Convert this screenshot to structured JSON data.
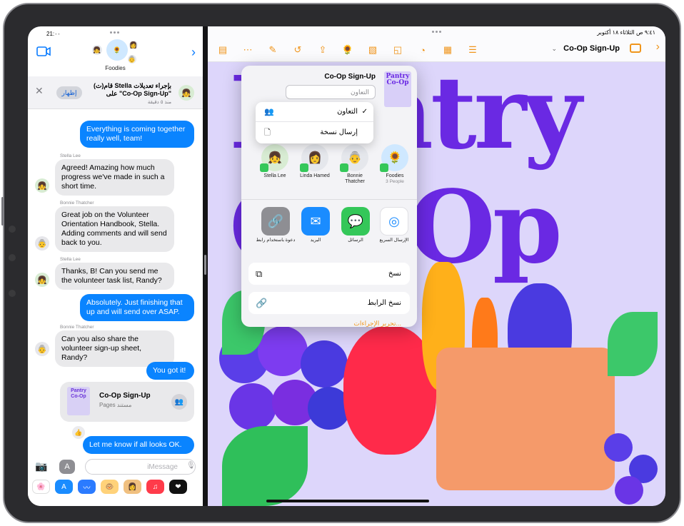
{
  "messages": {
    "status": {
      "time": "21:٠٠",
      "signal": "▮▮▮"
    },
    "header": {
      "group_name": "Foodies"
    },
    "banner": {
      "show_label": "إظهار",
      "line1": "قام(ت) Stella بإجراء تعديلات",
      "line2": "على \"Co-Op Sign-Up\"",
      "time": "منذ ٥ دقيقة"
    },
    "thread": [
      {
        "from": "me",
        "text": "Everything is coming together really well, team!"
      },
      {
        "from": "Stella Lee",
        "text": "Agreed! Amazing how much progress we've made in such a short time."
      },
      {
        "from": "Bonnie Thatcher",
        "text": "Great job on the Volunteer Orientation Handbook, Stella. Adding comments and will send back to you."
      },
      {
        "from": "Stella Lee",
        "text": "Thanks, B! Can you send me the volunteer task list, Randy?"
      },
      {
        "from": "me",
        "text": "Absolutely. Just finishing that up and will send over ASAP."
      },
      {
        "from": "Bonnie Thatcher",
        "text": "Can you also share the volunteer sign-up sheet, Randy?"
      },
      {
        "from": "me",
        "text": "You got it!"
      },
      {
        "from": "me",
        "text": "Let me know if all looks OK."
      }
    ],
    "sender_names": {
      "stella": "Stella Lee",
      "bonnie": "Bonnie Thatcher"
    },
    "card": {
      "title": "Co-Op Sign-Up",
      "subtitle": "Pages مستند",
      "thumb_text": "Pantry Co-Op"
    },
    "compose": {
      "placeholder": "iMessage"
    }
  },
  "pages": {
    "status": {
      "time": "٩:٤١ ص",
      "date": "الثلاثاء ١٨ أكتوبر"
    },
    "doc_title": "Co-Op Sign-Up",
    "poster": {
      "line1": "Pantry",
      "line2": "Co-Op"
    },
    "toolbar_icons": [
      "document-icon",
      "more-icon",
      "brush-icon",
      "undo-icon",
      "share-icon",
      "collab-icon",
      "media-icon",
      "shapes-icon",
      "chart-icon",
      "table-icon",
      "text-icon"
    ]
  },
  "share_sheet": {
    "title": "Co-Op Sign-Up",
    "thumb_text": "Pantry Co-Op",
    "collab_value": "التعاون",
    "dropdown": [
      {
        "label": "التعاون",
        "checked": true
      },
      {
        "label": "إرسال نسخة",
        "checked": false
      }
    ],
    "people": [
      {
        "name": "Foodies",
        "sub": "3 People"
      },
      {
        "name": "Bonnie Thatcher",
        "sub": ""
      },
      {
        "name": "Linda Hamed",
        "sub": ""
      },
      {
        "name": "Stella Lee",
        "sub": ""
      }
    ],
    "apps": [
      {
        "label": "الإرسال السريع",
        "color": "#ffffff"
      },
      {
        "label": "الرسائل",
        "color": "#34c759"
      },
      {
        "label": "البريد",
        "color": "#1a8cff"
      },
      {
        "label": "دعوة باستخدام رابط",
        "color": "#8e8e93"
      }
    ],
    "actions": [
      {
        "label": "نسخ"
      },
      {
        "label": "نسخ الرابط"
      }
    ],
    "edit_actions": "تحرير الإجراءات..."
  }
}
